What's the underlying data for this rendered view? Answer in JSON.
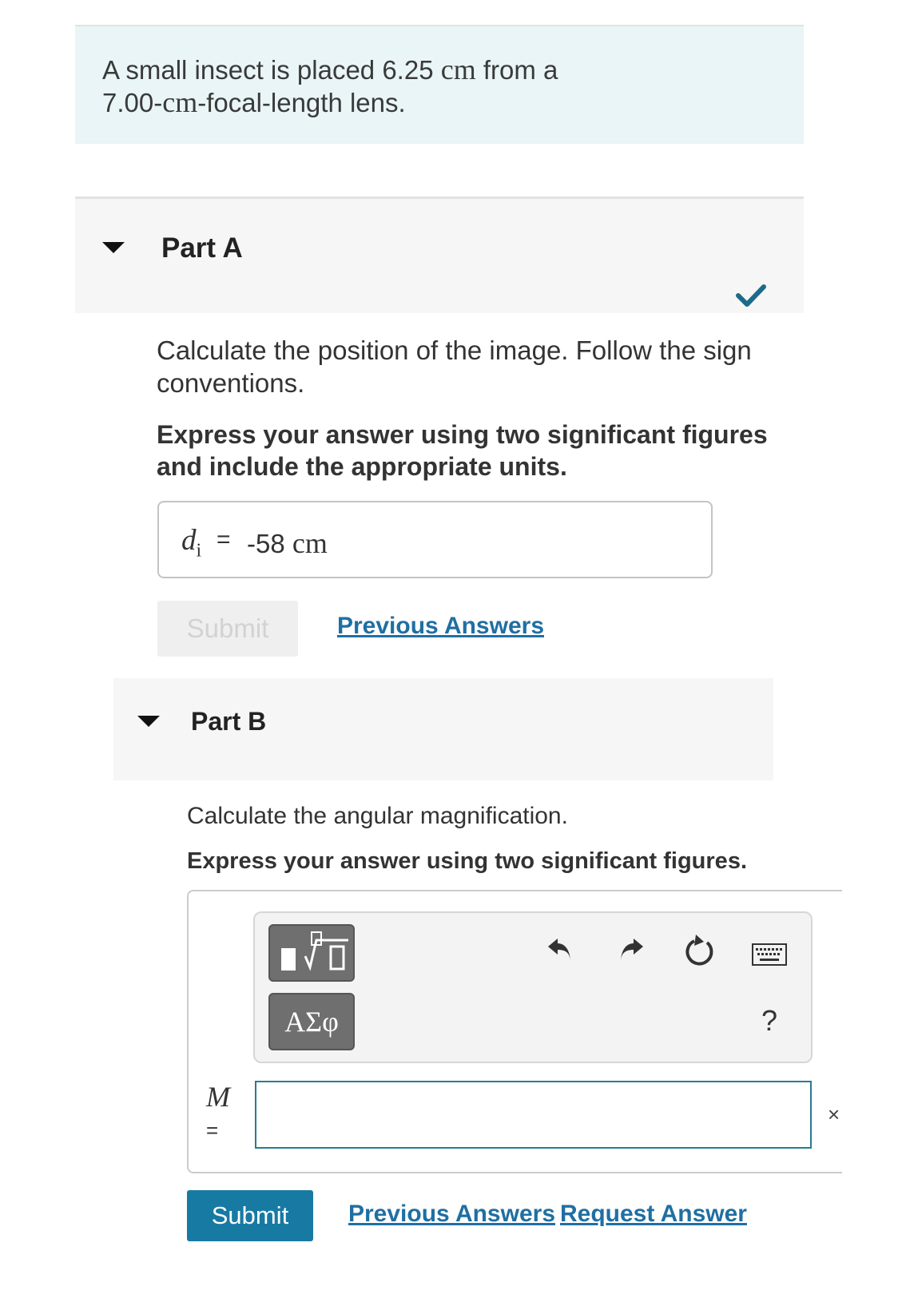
{
  "intro": {
    "line1_prefix": "A small insect is placed 6.25",
    "line1_unit": "cm",
    "line1_suffix": "from a",
    "line2_prefix": "7.00-",
    "line2_unit": "cm",
    "line2_suffix": "-focal-length lens."
  },
  "part_a": {
    "title": "Part A",
    "status": "correct",
    "question": "Calculate the position of the image. Follow the sign conventions.",
    "instructions": "Express your answer using two significant figures and include the appropriate units.",
    "answer_var": "d",
    "answer_sub": "i",
    "answer_eq": "=",
    "answer_value": "-58",
    "answer_unit": "cm",
    "submit_label": "Submit",
    "previous_answers_label": "Previous Answers"
  },
  "part_b": {
    "title": "Part B",
    "question": "Calculate the angular magnification.",
    "instructions": "Express your answer using two significant figures.",
    "toolbar": {
      "template_icon": "fraction-root-template-icon",
      "greek_label": "ΑΣφ",
      "help_label": "?"
    },
    "input_var": "M",
    "input_eq": "=",
    "input_value": "",
    "close_glyph": "×",
    "submit_label": "Submit",
    "previous_answers_label": "Previous Answers",
    "request_answer_label": "Request Answer"
  },
  "colors": {
    "intro_bg": "#e9f5f6",
    "primary": "#177aa3",
    "link": "#1f6fa3",
    "check": "#1d6a8a"
  }
}
